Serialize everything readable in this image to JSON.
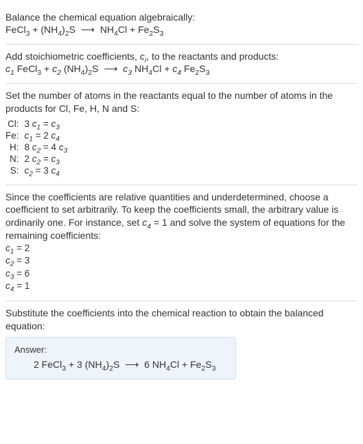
{
  "section1": {
    "line1": "Balance the chemical equation algebraically:",
    "eq_lhs1": "FeCl",
    "eq_sub1": "3",
    "eq_plus1": " + (NH",
    "eq_sub2": "4",
    "eq_rpar": ")",
    "eq_sub3": "2",
    "eq_s": "S",
    "eq_arrow": "⟶",
    "eq_rhs1": "NH",
    "eq_sub4": "4",
    "eq_cl": "Cl + Fe",
    "eq_sub5": "2",
    "eq_s2": "S",
    "eq_sub6": "3"
  },
  "section2": {
    "line1a": "Add stoichiometric coefficients, ",
    "ci": "c",
    "ci_sub": "i",
    "line1b": ", to the reactants and products:",
    "c1": "c",
    "c1s": "1",
    "fecl": " FeCl",
    "fecls": "3",
    "plus1": " + ",
    "c2": "c",
    "c2s": "2",
    "nh4a": " (NH",
    "nh4as": "4",
    "nh4b": ")",
    "nh4bs": "2",
    "nh4c": "S",
    "arrow": "⟶",
    "c3": "c",
    "c3s": "3",
    "nh4cl_a": " NH",
    "nh4cl_as": "4",
    "nh4cl_b": "Cl + ",
    "c4": "c",
    "c4s": "4",
    "fe2s3_a": " Fe",
    "fe2s3_as": "2",
    "fe2s3_b": "S",
    "fe2s3_bs": "3"
  },
  "section3": {
    "intro": "Set the number of atoms in the reactants equal to the number of atoms in the products for Cl, Fe, H, N and S:",
    "rows": [
      {
        "label": "Cl:",
        "lhs_a": "3 ",
        "lhs_c": "c",
        "lhs_s": "1",
        "eq": " = ",
        "rhs_c": "c",
        "rhs_s": "3",
        "rhs_tail": ""
      },
      {
        "label": "Fe:",
        "lhs_a": "",
        "lhs_c": "c",
        "lhs_s": "1",
        "eq": " = 2 ",
        "rhs_c": "c",
        "rhs_s": "4",
        "rhs_tail": ""
      },
      {
        "label": "H:",
        "lhs_a": "8 ",
        "lhs_c": "c",
        "lhs_s": "2",
        "eq": " = 4 ",
        "rhs_c": "c",
        "rhs_s": "3",
        "rhs_tail": ""
      },
      {
        "label": "N:",
        "lhs_a": "2 ",
        "lhs_c": "c",
        "lhs_s": "2",
        "eq": " = ",
        "rhs_c": "c",
        "rhs_s": "3",
        "rhs_tail": ""
      },
      {
        "label": "S:",
        "lhs_a": "",
        "lhs_c": "c",
        "lhs_s": "2",
        "eq": " = 3 ",
        "rhs_c": "c",
        "rhs_s": "4",
        "rhs_tail": ""
      }
    ]
  },
  "section4": {
    "text_a": "Since the coefficients are relative quantities and underdetermined, choose a coefficient to set arbitrarily. To keep the coefficients small, the arbitrary value is ordinarily one. For instance, set ",
    "c4": "c",
    "c4s": "4",
    "text_b": " = 1 and solve the system of equations for the remaining coefficients:",
    "coefs": [
      {
        "c": "c",
        "s": "1",
        "v": " = 2"
      },
      {
        "c": "c",
        "s": "2",
        "v": " = 3"
      },
      {
        "c": "c",
        "s": "3",
        "v": " = 6"
      },
      {
        "c": "c",
        "s": "4",
        "v": " = 1"
      }
    ]
  },
  "section5": {
    "intro": "Substitute the coefficients into the chemical reaction to obtain the balanced equation:",
    "answer_label": "Answer:",
    "eq": {
      "a": "2 FeCl",
      "as": "3",
      "b": " + 3 (NH",
      "bs": "4",
      "c": ")",
      "cs": "2",
      "d": "S",
      "arrow": "⟶",
      "e": "6 NH",
      "es": "4",
      "f": "Cl + Fe",
      "fs": "2",
      "g": "S",
      "gs": "3"
    }
  }
}
